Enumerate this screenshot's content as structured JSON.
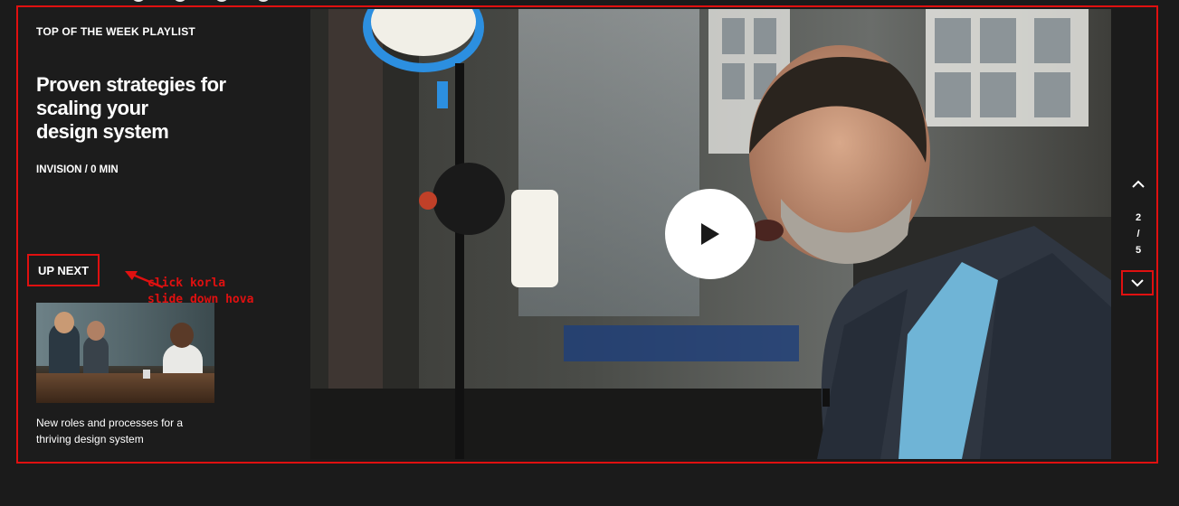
{
  "playlist": {
    "eyebrow": "TOP OF THE WEEK PLAYLIST",
    "title": "Proven strategies for\nscaling your\ndesign system",
    "meta": "INVISION / 0 MIN"
  },
  "up_next": {
    "label": "UP NEXT",
    "title": "New roles and processes for a\nthriving design system"
  },
  "annotation": {
    "text": "click korla\nslide down hova",
    "color": "#e01010"
  },
  "video": {
    "play_icon": "play-icon"
  },
  "pager": {
    "current": "2",
    "separator": "/",
    "total": "5",
    "up_icon": "chevron-up-icon",
    "down_icon": "chevron-down-icon"
  },
  "colors": {
    "background": "#1b1b1b",
    "text": "#ffffff",
    "highlight": "#e01010"
  }
}
